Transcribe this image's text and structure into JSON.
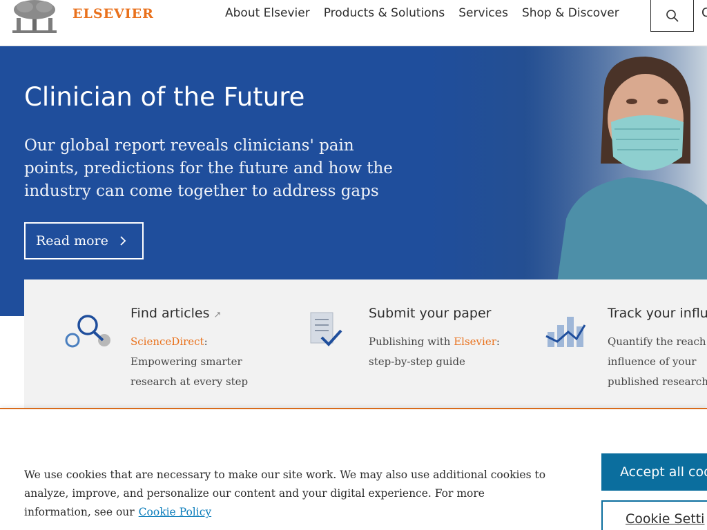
{
  "header": {
    "brand": "ELSEVIER",
    "nav": [
      "About Elsevier",
      "Products & Solutions",
      "Services",
      "Shop & Discover"
    ],
    "edge_glyph": "C"
  },
  "hero": {
    "title": "Clinician of the Future",
    "description": "Our global report reveals clinicians' pain points, predictions for the future and how the industry can come together to address gaps",
    "cta_label": "Read more"
  },
  "cards": [
    {
      "title": "Find articles",
      "icon": "magnifier-icon",
      "link_text": "ScienceDirect",
      "text_after_link": ":",
      "lines": [
        "Empowering smarter",
        "research at every step"
      ]
    },
    {
      "title": "Submit your paper",
      "icon": "document-check-icon",
      "prefix": "Publishing with ",
      "link_text": "Elsevier",
      "text_after_link": ":",
      "lines": [
        "step-by-step guide"
      ]
    },
    {
      "title": "Track your influ",
      "icon": "bar-chart-icon",
      "lines": [
        "Quantify the reach",
        "influence of your",
        "published research"
      ]
    }
  ],
  "cookie": {
    "text": "We use cookies that are necessary to make our site work. We may also use additional cookies to analyze, improve, and personalize our content and your digital experience. For more information, see our",
    "link_label": "Cookie Policy",
    "accept_label": "Accept all coo",
    "settings_label": "Cookie Setti"
  },
  "colors": {
    "brand_orange": "#e9711c",
    "hero_blue": "#1f4e9c",
    "button_blue": "#0b6e9e",
    "link_blue": "#0b7dbb"
  }
}
